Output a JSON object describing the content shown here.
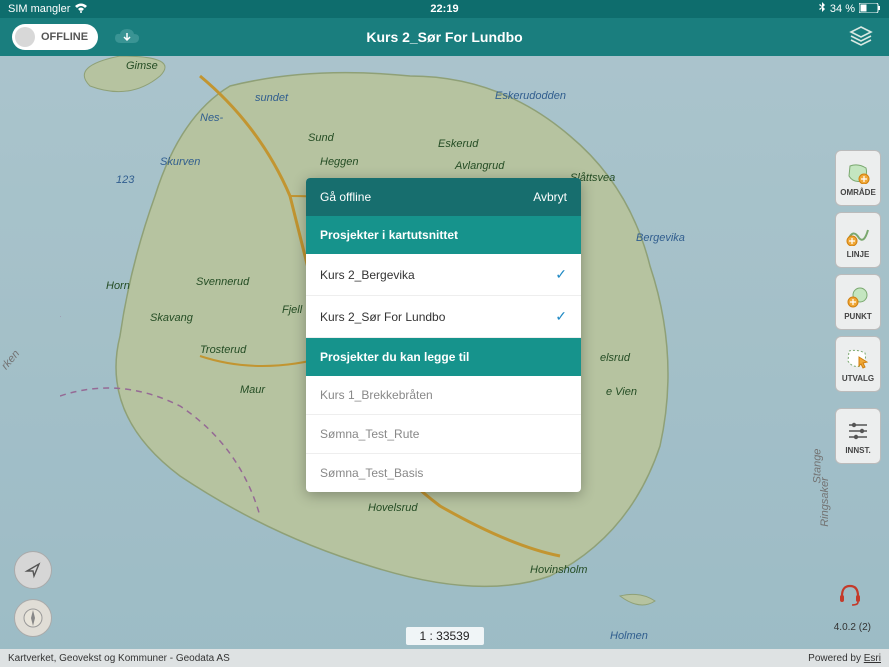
{
  "status_bar": {
    "sim_text": "SIM mangler",
    "time": "22:19",
    "battery_text": "34 %"
  },
  "header": {
    "offline_label": "OFFLINE",
    "title": "Kurs 2_Sør For Lundbo"
  },
  "map_labels": {
    "gimse": "Gimse",
    "sundet": "sundet",
    "nes": "Nes-",
    "eskerudodden": "Eskerudodden",
    "sund": "Sund",
    "eskerud": "Eskerud",
    "heggen": "Heggen",
    "avlangrud": "Avlangrud",
    "slattsvea": "Slåttsvea",
    "skurven": "Skurven",
    "depth": "123",
    "bergevika": "Bergevika",
    "horn": "Horn",
    "svennerud": "Svennerud",
    "skavang": "Skavang",
    "fjell": "Fjell",
    "trosterud": "Trosterud",
    "elsrud": "elsrud",
    "maur": "Maur",
    "evien": "e Vien",
    "hovelsrud": "Hovelsrud",
    "hovinsholm": "Hovinsholm",
    "holmen": "Holmen",
    "stange": "Stange",
    "ringsaker": "Ringsaker",
    "orken": "rken"
  },
  "tools": {
    "omrade": "OMRÅDE",
    "linje": "LINJE",
    "punkt": "PUNKT",
    "utvalg": "UTVALG",
    "innst": "INNST."
  },
  "modal": {
    "title": "Gå offline",
    "cancel": "Avbryt",
    "section_in_extent": "Prosjekter i kartutsnittet",
    "section_can_add_prefix": "Prosjekter du ",
    "section_can_add_bold": "kan legge til",
    "items_included": [
      "Kurs 2_Bergevika",
      "Kurs 2_Sør For Lundbo"
    ],
    "items_available": [
      "Kurs 1_Brekkebråten",
      "Sømna_Test_Rute",
      "Sømna_Test_Basis"
    ]
  },
  "scale": "1 : 33539",
  "version": "4.0.2 (2)",
  "footer": {
    "attribution": "Kartverket, Geovekst og Kommuner - Geodata AS",
    "powered_prefix": "Powered by ",
    "powered_link": "Esri"
  }
}
